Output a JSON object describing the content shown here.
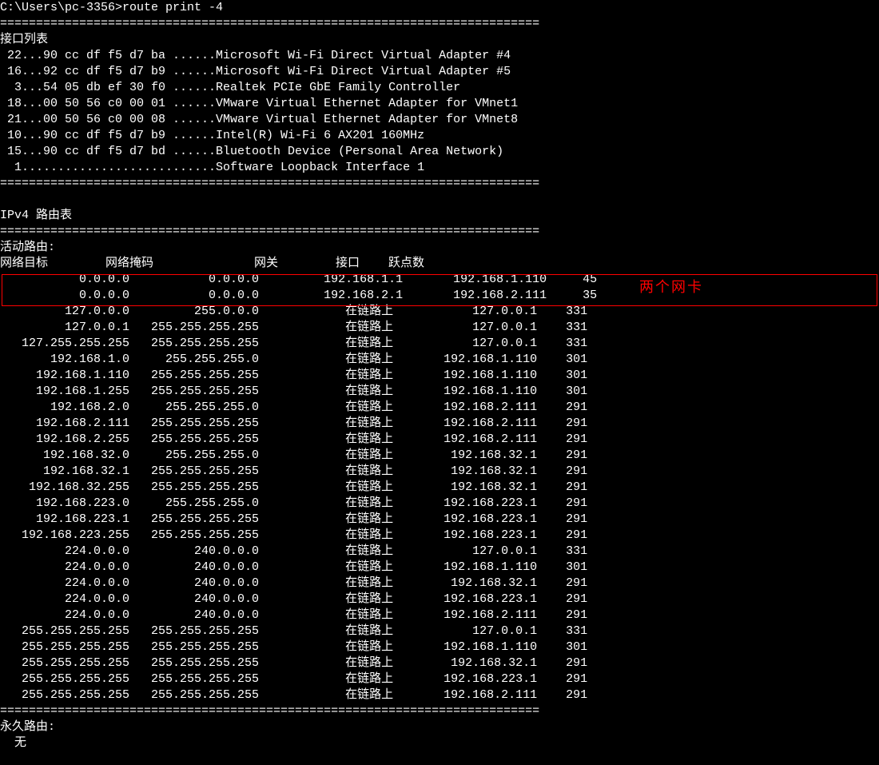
{
  "prompt": "C:\\Users\\pc-3356>",
  "command": "route print -4",
  "separator": "===========================================================================",
  "sections": {
    "interface_list_title": "接口列表",
    "interfaces": [
      " 22...90 cc df f5 d7 ba ......Microsoft Wi-Fi Direct Virtual Adapter #4",
      " 16...92 cc df f5 d7 b9 ......Microsoft Wi-Fi Direct Virtual Adapter #5",
      "  3...54 05 db ef 30 f0 ......Realtek PCIe GbE Family Controller",
      " 18...00 50 56 c0 00 01 ......VMware Virtual Ethernet Adapter for VMnet1",
      " 21...00 50 56 c0 00 08 ......VMware Virtual Ethernet Adapter for VMnet8",
      " 10...90 cc df f5 d7 b9 ......Intel(R) Wi-Fi 6 AX201 160MHz",
      " 15...90 cc df f5 d7 bd ......Bluetooth Device (Personal Area Network)",
      "  1...........................Software Loopback Interface 1"
    ],
    "ipv4_title": "IPv4 路由表",
    "active_routes_title": "活动路由:",
    "route_header": {
      "dest": "网络目标",
      "mask": "网络掩码",
      "gateway": "网关",
      "iface": "接口",
      "metric": "跃点数"
    },
    "highlighted_routes": [
      {
        "dest": "0.0.0.0",
        "mask": "0.0.0.0",
        "gateway": "192.168.1.1",
        "iface": "192.168.1.110",
        "metric": "45"
      },
      {
        "dest": "0.0.0.0",
        "mask": "0.0.0.0",
        "gateway": "192.168.2.1",
        "iface": "192.168.2.111",
        "metric": "35"
      }
    ],
    "routes": [
      {
        "dest": "127.0.0.0",
        "mask": "255.0.0.0",
        "gateway": "在链路上",
        "iface": "127.0.0.1",
        "metric": "331"
      },
      {
        "dest": "127.0.0.1",
        "mask": "255.255.255.255",
        "gateway": "在链路上",
        "iface": "127.0.0.1",
        "metric": "331"
      },
      {
        "dest": "127.255.255.255",
        "mask": "255.255.255.255",
        "gateway": "在链路上",
        "iface": "127.0.0.1",
        "metric": "331"
      },
      {
        "dest": "192.168.1.0",
        "mask": "255.255.255.0",
        "gateway": "在链路上",
        "iface": "192.168.1.110",
        "metric": "301"
      },
      {
        "dest": "192.168.1.110",
        "mask": "255.255.255.255",
        "gateway": "在链路上",
        "iface": "192.168.1.110",
        "metric": "301"
      },
      {
        "dest": "192.168.1.255",
        "mask": "255.255.255.255",
        "gateway": "在链路上",
        "iface": "192.168.1.110",
        "metric": "301"
      },
      {
        "dest": "192.168.2.0",
        "mask": "255.255.255.0",
        "gateway": "在链路上",
        "iface": "192.168.2.111",
        "metric": "291"
      },
      {
        "dest": "192.168.2.111",
        "mask": "255.255.255.255",
        "gateway": "在链路上",
        "iface": "192.168.2.111",
        "metric": "291"
      },
      {
        "dest": "192.168.2.255",
        "mask": "255.255.255.255",
        "gateway": "在链路上",
        "iface": "192.168.2.111",
        "metric": "291"
      },
      {
        "dest": "192.168.32.0",
        "mask": "255.255.255.0",
        "gateway": "在链路上",
        "iface": "192.168.32.1",
        "metric": "291"
      },
      {
        "dest": "192.168.32.1",
        "mask": "255.255.255.255",
        "gateway": "在链路上",
        "iface": "192.168.32.1",
        "metric": "291"
      },
      {
        "dest": "192.168.32.255",
        "mask": "255.255.255.255",
        "gateway": "在链路上",
        "iface": "192.168.32.1",
        "metric": "291"
      },
      {
        "dest": "192.168.223.0",
        "mask": "255.255.255.0",
        "gateway": "在链路上",
        "iface": "192.168.223.1",
        "metric": "291"
      },
      {
        "dest": "192.168.223.1",
        "mask": "255.255.255.255",
        "gateway": "在链路上",
        "iface": "192.168.223.1",
        "metric": "291"
      },
      {
        "dest": "192.168.223.255",
        "mask": "255.255.255.255",
        "gateway": "在链路上",
        "iface": "192.168.223.1",
        "metric": "291"
      },
      {
        "dest": "224.0.0.0",
        "mask": "240.0.0.0",
        "gateway": "在链路上",
        "iface": "127.0.0.1",
        "metric": "331"
      },
      {
        "dest": "224.0.0.0",
        "mask": "240.0.0.0",
        "gateway": "在链路上",
        "iface": "192.168.1.110",
        "metric": "301"
      },
      {
        "dest": "224.0.0.0",
        "mask": "240.0.0.0",
        "gateway": "在链路上",
        "iface": "192.168.32.1",
        "metric": "291"
      },
      {
        "dest": "224.0.0.0",
        "mask": "240.0.0.0",
        "gateway": "在链路上",
        "iface": "192.168.223.1",
        "metric": "291"
      },
      {
        "dest": "224.0.0.0",
        "mask": "240.0.0.0",
        "gateway": "在链路上",
        "iface": "192.168.2.111",
        "metric": "291"
      },
      {
        "dest": "255.255.255.255",
        "mask": "255.255.255.255",
        "gateway": "在链路上",
        "iface": "127.0.0.1",
        "metric": "331"
      },
      {
        "dest": "255.255.255.255",
        "mask": "255.255.255.255",
        "gateway": "在链路上",
        "iface": "192.168.1.110",
        "metric": "301"
      },
      {
        "dest": "255.255.255.255",
        "mask": "255.255.255.255",
        "gateway": "在链路上",
        "iface": "192.168.32.1",
        "metric": "291"
      },
      {
        "dest": "255.255.255.255",
        "mask": "255.255.255.255",
        "gateway": "在链路上",
        "iface": "192.168.223.1",
        "metric": "291"
      },
      {
        "dest": "255.255.255.255",
        "mask": "255.255.255.255",
        "gateway": "在链路上",
        "iface": "192.168.2.111",
        "metric": "291"
      }
    ],
    "persistent_routes_title": "永久路由:",
    "persistent_none": "  无"
  },
  "annotation": {
    "label": "两个网卡"
  }
}
